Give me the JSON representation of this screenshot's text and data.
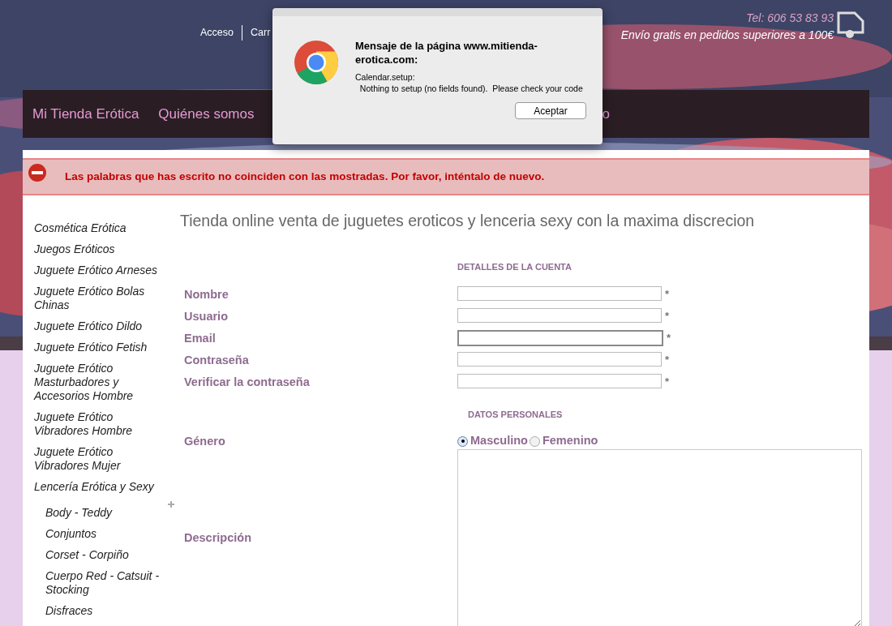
{
  "header": {
    "links": [
      "Acceso",
      "Carr"
    ],
    "phone": "Tel: 606 53 83 93",
    "shipping": "Envío gratis en pedidos superiores a 100€"
  },
  "nav": {
    "items": [
      "Mi Tienda Erótica",
      "Quiénes somos",
      "o"
    ]
  },
  "dialog": {
    "title": "Mensaje de la página www.mitienda-erotica.com:",
    "body": "Calendar.setup:\n  Nothing to setup (no fields found).  Please check your code",
    "button": "Aceptar"
  },
  "error": "Las palabras que has escrito no coinciden con las mostradas. Por favor, inténtalo de nuevo.",
  "sidebar": {
    "items": [
      {
        "label": "Cosmética Erótica"
      },
      {
        "label": "Juegos Eróticos"
      },
      {
        "label": "Juguete Erótico Arneses"
      },
      {
        "label": "Juguete Erótico Bolas Chinas"
      },
      {
        "label": "Juguete Erótico Dildo"
      },
      {
        "label": "Juguete Erótico Fetish"
      },
      {
        "label": "Juguete Erótico Masturbadores y Accesorios Hombre"
      },
      {
        "label": "Juguete Erótico Vibradores Hombre"
      },
      {
        "label": "Juguete Erótico Vibradores Mujer"
      },
      {
        "label": "Lencería Erótica y Sexy",
        "expanded": true,
        "children": [
          {
            "label": "Body - Teddy"
          },
          {
            "label": "Conjuntos"
          },
          {
            "label": "Corset - Corpiño"
          },
          {
            "label": "Cuerpo Red - Catsuit - Stocking"
          },
          {
            "label": "Disfraces"
          }
        ]
      }
    ]
  },
  "page_title": "Tienda online venta de juguetes eroticos y lenceria sexy con la maxima discrecion",
  "account": {
    "heading": "DETALLES DE LA CUENTA",
    "fields": [
      {
        "label": "Nombre",
        "required": "*",
        "focused": false
      },
      {
        "label": "Usuario",
        "required": "*",
        "focused": false
      },
      {
        "label": "Email",
        "required": "*",
        "focused": true
      },
      {
        "label": "Contraseña",
        "required": "*",
        "focused": false
      },
      {
        "label": "Verificar la contraseña",
        "required": "*",
        "focused": false
      }
    ]
  },
  "personal": {
    "heading": "DATOS PERSONALES",
    "gender": {
      "label": "Género",
      "options": [
        {
          "label": "Masculino",
          "selected": true
        },
        {
          "label": "Femenino",
          "selected": false
        }
      ]
    },
    "description": {
      "label": "Descripción"
    }
  }
}
